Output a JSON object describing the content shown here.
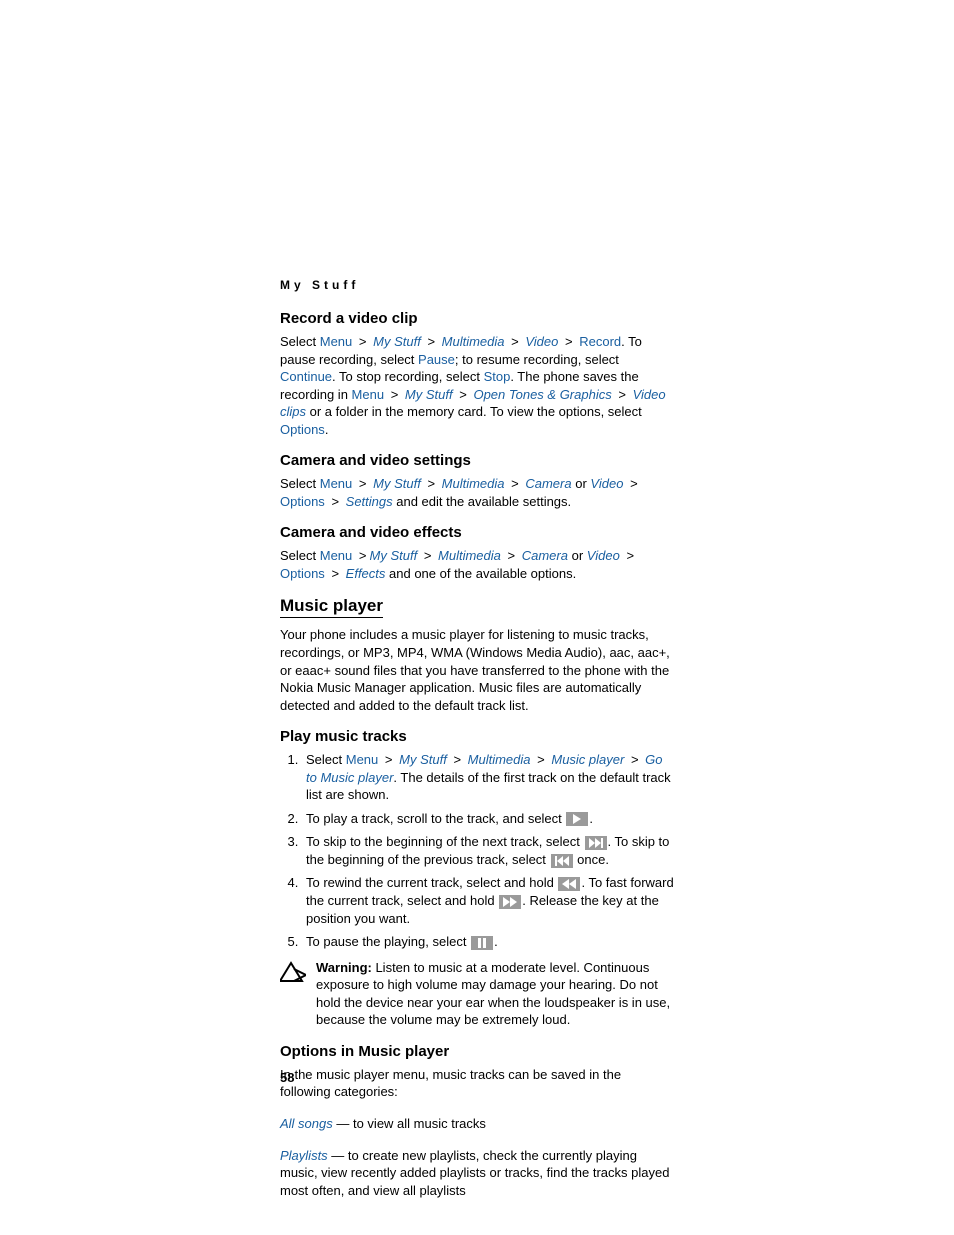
{
  "header": "My Stuff",
  "pageNumber": "58",
  "sep": ">",
  "or": "or",
  "sections": {
    "record": {
      "title": "Record a video clip",
      "t_select": "Select ",
      "menu": "Menu",
      "mystuff": "My Stuff",
      "multimedia": "Multimedia",
      "video": "Video",
      "record": "Record",
      "t1": ". To pause recording, select ",
      "pause": "Pause",
      "t2": "; to resume recording, select ",
      "continue": "Continue",
      "t3": ". To stop recording, select ",
      "stop": "Stop",
      "t4": ". The phone saves the recording in ",
      "open": "Open Tones & Graphics",
      "clips": "Video clips",
      "t5": " or a folder in the memory card. To view the options, select ",
      "options": "Options",
      "dot": "."
    },
    "settings": {
      "title": "Camera and video settings",
      "t_select": "Select ",
      "menu": "Menu",
      "mystuff": "My Stuff",
      "multimedia": "Multimedia",
      "camera": "Camera",
      "video": "Video",
      "options": "Options",
      "settings": "Settings",
      "tail": " and edit the available settings."
    },
    "effects": {
      "title": "Camera and video effects",
      "t_select": "Select ",
      "menu": "Menu",
      "mystuff": "My Stuff",
      "multimedia": "Multimedia",
      "camera": "Camera",
      "video": "Video",
      "options": "Options",
      "effects": "Effects",
      "tail": " and one of the available options."
    },
    "music": {
      "title": "Music player",
      "intro": "Your phone includes a music player for listening to music tracks, recordings, or MP3, MP4, WMA (Windows Media Audio), aac, aac+, or eaac+ sound files that you have transferred to the phone with the Nokia Music Manager application. Music files are automatically detected and added to the default track list."
    },
    "play": {
      "title": "Play music tracks",
      "step1_a": "Select ",
      "menu": "Menu",
      "mystuff": "My Stuff",
      "multimedia": "Multimedia",
      "musicplayer": "Music player",
      "goto": "Go to Music player",
      "step1_b": ". The details of the first track on the default track list are shown.",
      "step2_a": "To play a track, scroll to the track, and select ",
      "step2_b": ".",
      "step3_a": "To skip to the beginning of the next track, select ",
      "step3_b": ". To skip to the beginning of the previous track, select ",
      "step3_c": " once.",
      "step4_a": "To rewind the current track, select and hold ",
      "step4_b": ". To fast forward the current track, select and hold ",
      "step4_c": ". Release the key at the position you want.",
      "step5_a": "To pause the playing, select ",
      "step5_b": "."
    },
    "warning": {
      "label": "Warning:",
      "text": " Listen to music at a moderate level. Continuous exposure to high volume may damage your hearing. Do not hold the device near your ear when the loudspeaker is in use, because the volume may be extremely loud."
    },
    "options": {
      "title": "Options in Music player",
      "intro": "In the music player menu, music tracks can be saved in the following categories:",
      "allsongs": "All songs",
      "allsongs_t": " — to view all music tracks",
      "playlists": "Playlists",
      "playlists_t": " — to create new playlists, check the currently playing music, view recently added playlists or tracks, find the tracks played most often, and view all playlists"
    }
  }
}
